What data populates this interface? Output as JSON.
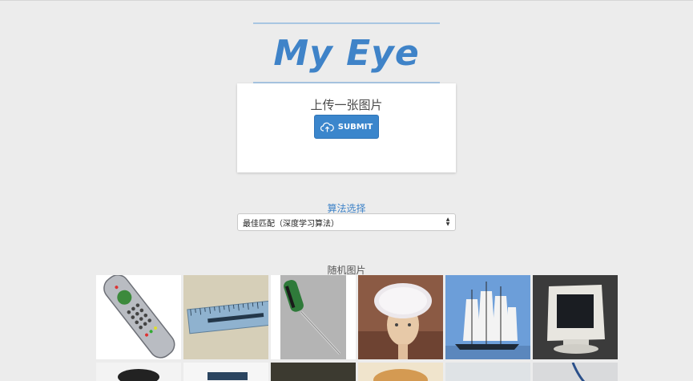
{
  "app": {
    "logo_text": "My Eye"
  },
  "upload": {
    "title": "上传一张图片",
    "submit_label": "SUBMIT"
  },
  "algorithm": {
    "label": "算法选择",
    "selected": "最佳匹配（深度学习算法）"
  },
  "random": {
    "label": "随机图片",
    "images": [
      {
        "name": "remote-control-image",
        "bg": "#ffffff"
      },
      {
        "name": "ruler-image",
        "bg": "#d8d2bd"
      },
      {
        "name": "screwdriver-image",
        "bg": "#b8b8b8"
      },
      {
        "name": "mannequin-shower-cap-image",
        "bg": "#8a5a44"
      },
      {
        "name": "sailing-ship-image",
        "bg": "#6f9fd8"
      },
      {
        "name": "crt-monitor-image",
        "bg": "#3a3a3a"
      }
    ]
  },
  "colors": {
    "accent": "#3f83c8",
    "background": "#ececec"
  }
}
